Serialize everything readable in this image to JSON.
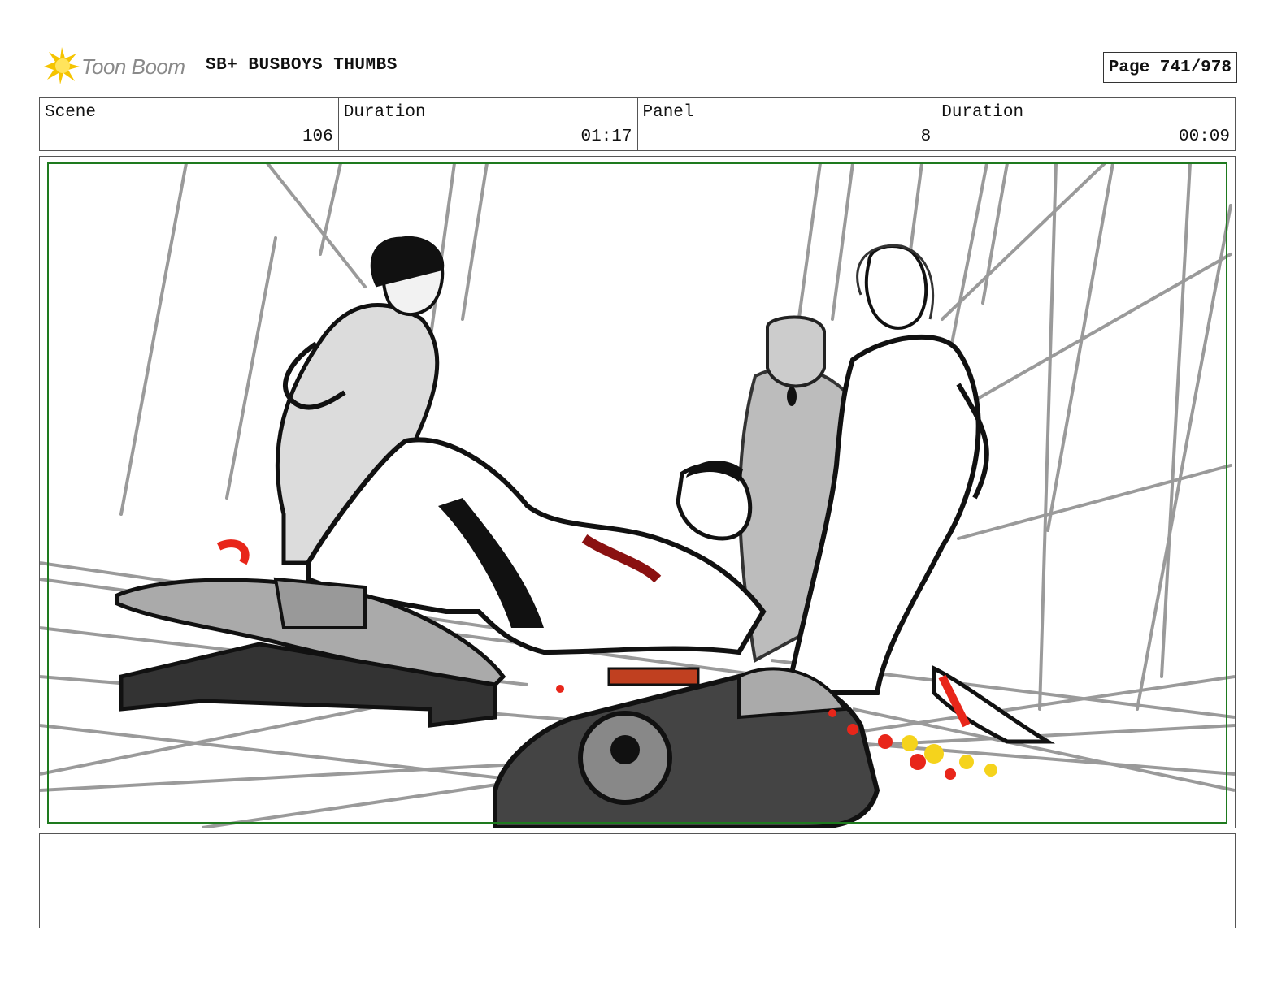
{
  "header": {
    "logo_text": "Toon Boom",
    "project_title": "SB+ BUSBOYS THUMBS",
    "page_label": "Page 741/978"
  },
  "info": {
    "scene_label": "Scene",
    "scene_value": "106",
    "scene_duration_label": "Duration",
    "scene_duration_value": "01:17",
    "panel_label": "Panel",
    "panel_value": "8",
    "panel_duration_label": "Duration",
    "panel_duration_value": "00:09"
  },
  "notes": {
    "text": ""
  },
  "colors": {
    "safe_frame": "#1e7a1e",
    "blood": "#e8261a",
    "muzzle_flash": "#f5d31c",
    "logo_yellow": "#f5c400",
    "sketch_gray": "#9a9a9a"
  }
}
